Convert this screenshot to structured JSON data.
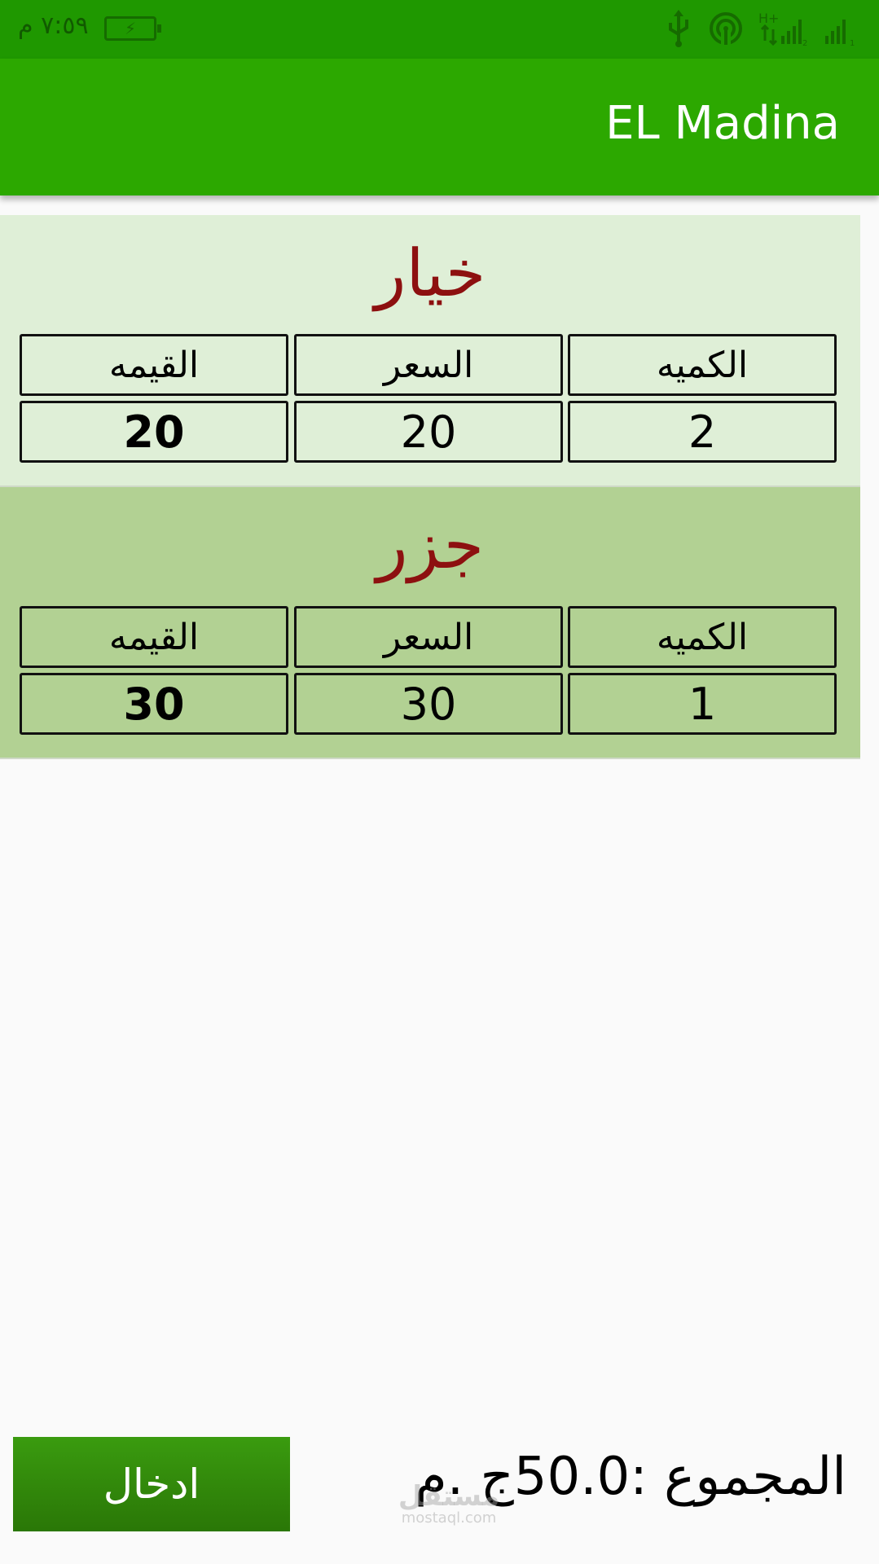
{
  "status_bar": {
    "time": "٧:٥٩ م",
    "icons": [
      "battery-charging-icon",
      "usb-icon",
      "hotspot-icon",
      "signal-hplus-icon",
      "signal-2-icon",
      "signal-1-icon"
    ],
    "network_label": "H+"
  },
  "app_bar": {
    "title": "EL Madina"
  },
  "items": [
    {
      "name": "خيار",
      "headers": {
        "quantity": "الكميه",
        "price": "السعر",
        "value": "القيمه"
      },
      "quantity": "2",
      "price": "20",
      "value": "20"
    },
    {
      "name": "جزر",
      "headers": {
        "quantity": "الكميه",
        "price": "السعر",
        "value": "القيمه"
      },
      "quantity": "1",
      "price": "30",
      "value": "30"
    }
  ],
  "footer": {
    "total_text": "المجموع :50.0ج .م",
    "submit_label": "ادخال"
  },
  "watermark": {
    "main": "مستقل",
    "sub": "mostaql.com"
  },
  "colors": {
    "status_bar": "#1f9800",
    "app_bar": "#2ca800",
    "card_1": "#dfefd7",
    "card_2": "#b2d193",
    "item_name": "#8d1010",
    "button": "#2f860a"
  }
}
